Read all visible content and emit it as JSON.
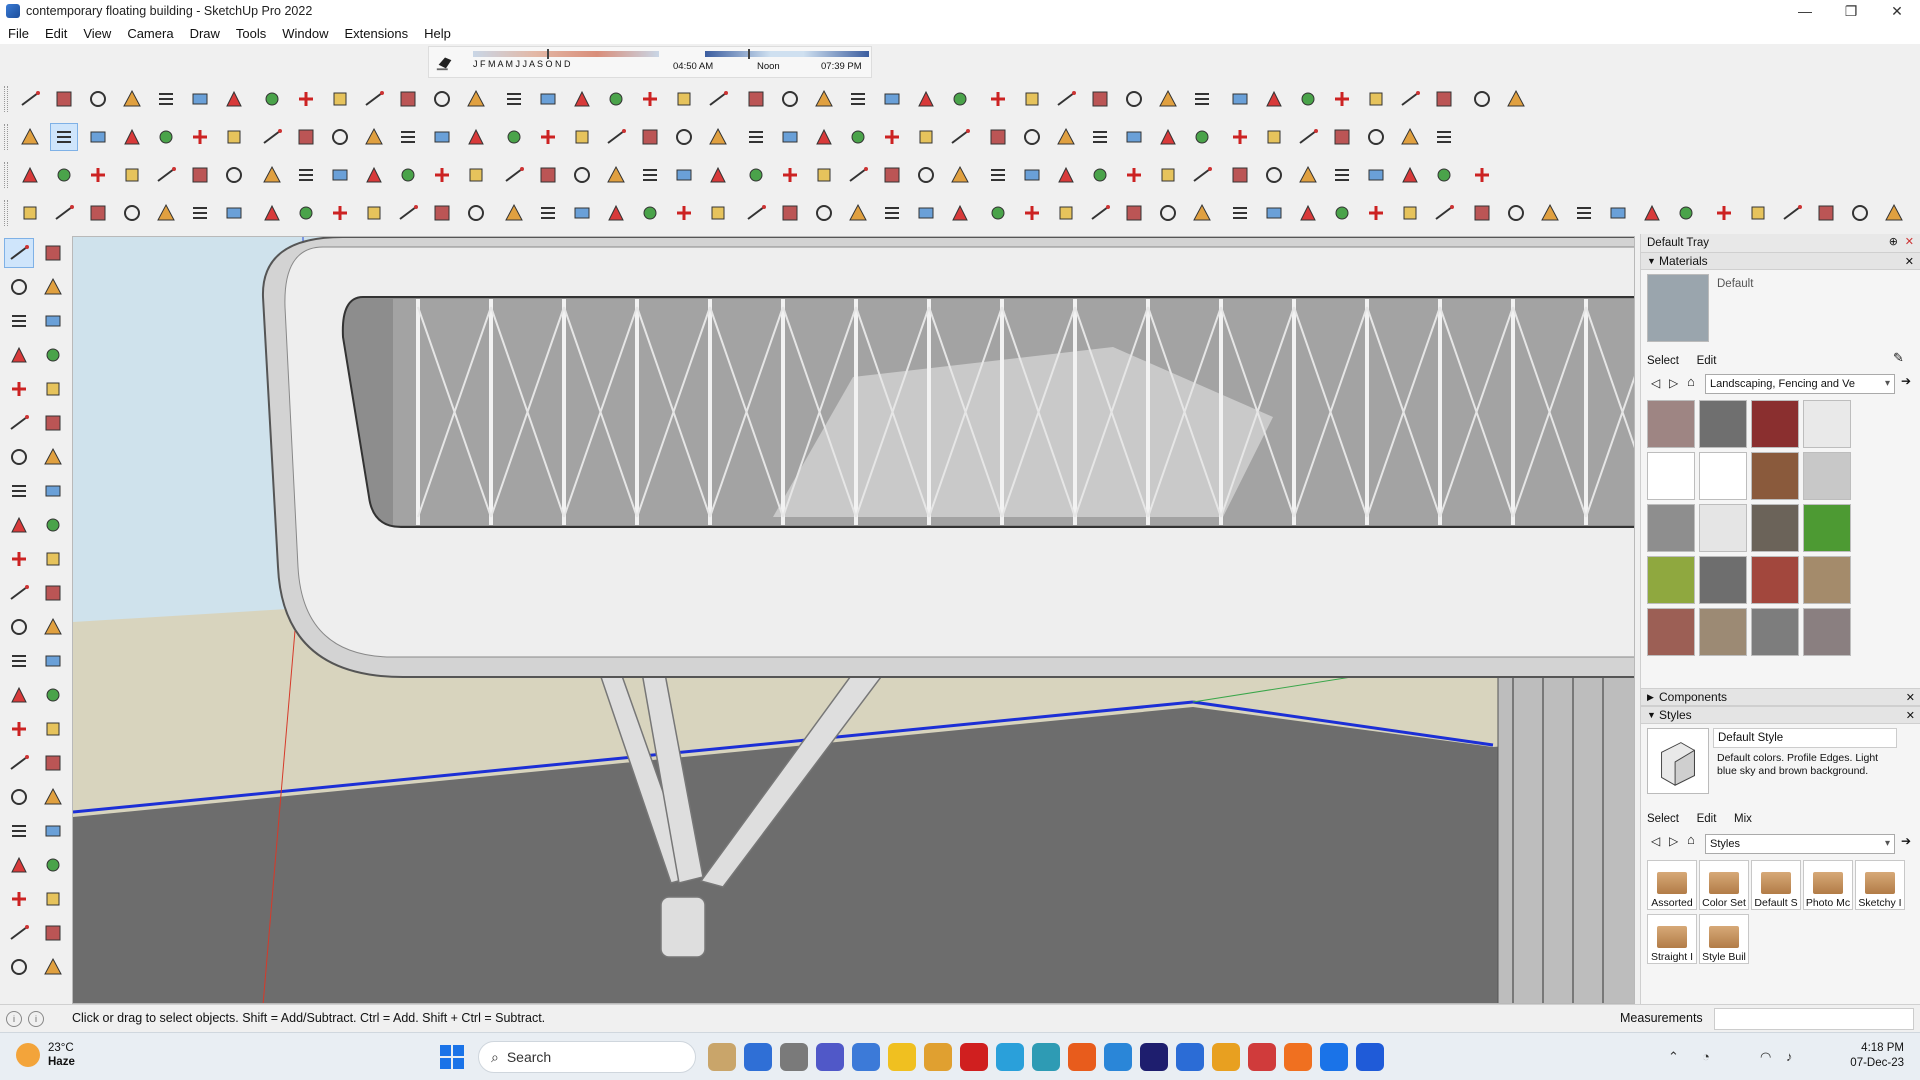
{
  "window": {
    "title": "contemporary floating building - SketchUp Pro 2022",
    "controls": [
      "—",
      "❐",
      "✕"
    ]
  },
  "menubar": [
    "File",
    "Edit",
    "View",
    "Camera",
    "Draw",
    "Tools",
    "Window",
    "Extensions",
    "Help"
  ],
  "shadow": {
    "months": "J F M A M J J A S O N D",
    "time_start": "04:50 AM",
    "time_mid": "Noon",
    "time_end": "07:39 PM"
  },
  "tray": {
    "title": "Default Tray",
    "materials": {
      "header": "Materials",
      "current_name": "Default",
      "tabs": [
        "Select",
        "Edit"
      ],
      "library": "Landscaping, Fencing and Ve",
      "swatch_colors": [
        "#9e8583",
        "#6f6f6f",
        "#8a2f2f",
        "#e9e9e9",
        "#ffffff",
        "#ffffff",
        "#8a5a3c",
        "#c8c8c8",
        "#8e8e8e",
        "#e5e5e5",
        "#6b6359",
        "#4d9a33",
        "#8fa83f",
        "#6e6e6e",
        "#a2473d",
        "#a48b6b",
        "#9c5f55",
        "#9c8a74",
        "#7d7d7d",
        "#8a7f80"
      ]
    },
    "components": {
      "header": "Components"
    },
    "styles": {
      "header": "Styles",
      "current_name": "Default Style",
      "description": "Default colors. Profile Edges. Light blue sky and brown background.",
      "tabs": [
        "Select",
        "Edit",
        "Mix"
      ],
      "library": "Styles",
      "folders": [
        "Assorted",
        "Color Set",
        "Default S",
        "Photo Mc",
        "Sketchy I",
        "Straight I",
        "Style Buil"
      ]
    }
  },
  "statusbar": {
    "hint": "Click or drag to select objects. Shift = Add/Subtract. Ctrl = Add. Shift + Ctrl = Subtract.",
    "measurements_label": "Measurements"
  },
  "taskbar": {
    "weather_temp": "23°C",
    "weather_desc": "Haze",
    "search_label": "Search",
    "time": "4:18 PM",
    "date": "07-Dec-23"
  },
  "colors": {
    "sky": "#cfe2ec",
    "ground": "#d8d4be",
    "selection": "#cfe5fb",
    "accent": "#1a73e8"
  }
}
